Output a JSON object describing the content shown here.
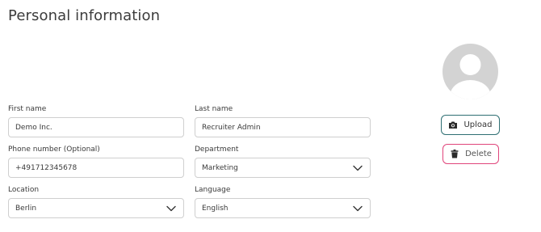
{
  "header": {
    "title": "Personal information"
  },
  "form": {
    "first_name": {
      "label": "First name",
      "value": "Demo Inc."
    },
    "last_name": {
      "label": "Last name",
      "value": "Recruiter Admin"
    },
    "phone": {
      "label": "Phone number (Optional)",
      "value": "+491712345678"
    },
    "department": {
      "label": "Department",
      "value": "Marketing"
    },
    "location": {
      "label": "Location",
      "value": "Berlin"
    },
    "language": {
      "label": "Language",
      "value": "English"
    }
  },
  "avatar": {
    "icon": "user-placeholder-icon"
  },
  "actions": {
    "upload_label": "Upload",
    "upload_icon": "camera-icon",
    "delete_label": "Delete",
    "delete_icon": "trash-icon"
  },
  "colors": {
    "upload_border": "#2f6f73",
    "delete_border": "#e0457b",
    "avatar_bg": "#d3d3d3"
  }
}
